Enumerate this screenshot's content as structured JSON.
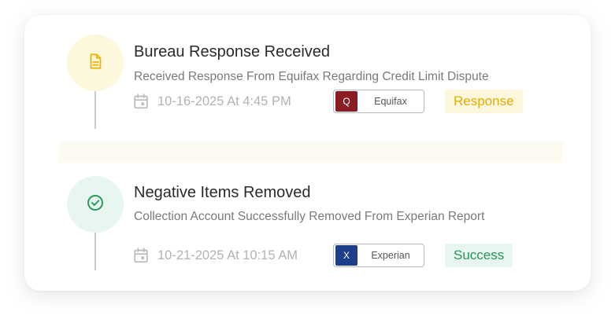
{
  "timeline": {
    "items": [
      {
        "title": "Bureau Response Received",
        "description": "Received Response From Equifax Regarding Credit Limit Dispute",
        "datetime": "10-16-2025 At 4:45 PM",
        "bureau": {
          "logo_letter": "Q",
          "name": "Equifax",
          "logo_color": "#8b1c24"
        },
        "status": {
          "label": "Response",
          "bg_color": "#fdf7dc",
          "text_color": "#e4ad06"
        },
        "icon": "document-icon",
        "icon_color": "#e8b511"
      },
      {
        "title": "Negative Items Removed",
        "description": "Collection Account Successfully Removed From Experian Report",
        "datetime": "10-21-2025 At 10:15 AM",
        "bureau": {
          "logo_letter": "X",
          "name": "Experian",
          "logo_color": "#1d3f8a"
        },
        "status": {
          "label": "Success",
          "bg_color": "#e7f6ee",
          "text_color": "#27955a"
        },
        "icon": "check-circle-icon",
        "icon_color": "#2b9d63"
      }
    ]
  }
}
